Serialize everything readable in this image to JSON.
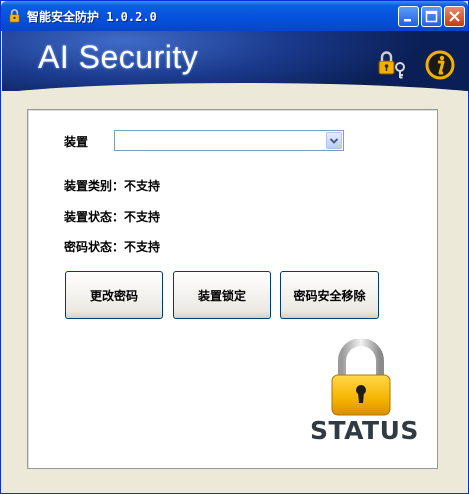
{
  "window": {
    "title": "智能安全防护 1.0.2.0"
  },
  "header": {
    "brand": "AI Security",
    "icons": [
      "key-lock-icon",
      "info-icon"
    ]
  },
  "device": {
    "label": "装置",
    "select_value": "",
    "type_line": "装置类别：不支持",
    "state_line": "装置状态：不支持",
    "password_state_line": "密码状态：不支持"
  },
  "buttons": {
    "change_password": "更改密码",
    "lock_device": "装置锁定",
    "remove_password": "密码安全移除"
  },
  "status": {
    "label": "STATUS"
  },
  "colors": {
    "titlebar": "#0550dc",
    "banner": "#0d2b73",
    "lock_gold": "#f5b400"
  }
}
